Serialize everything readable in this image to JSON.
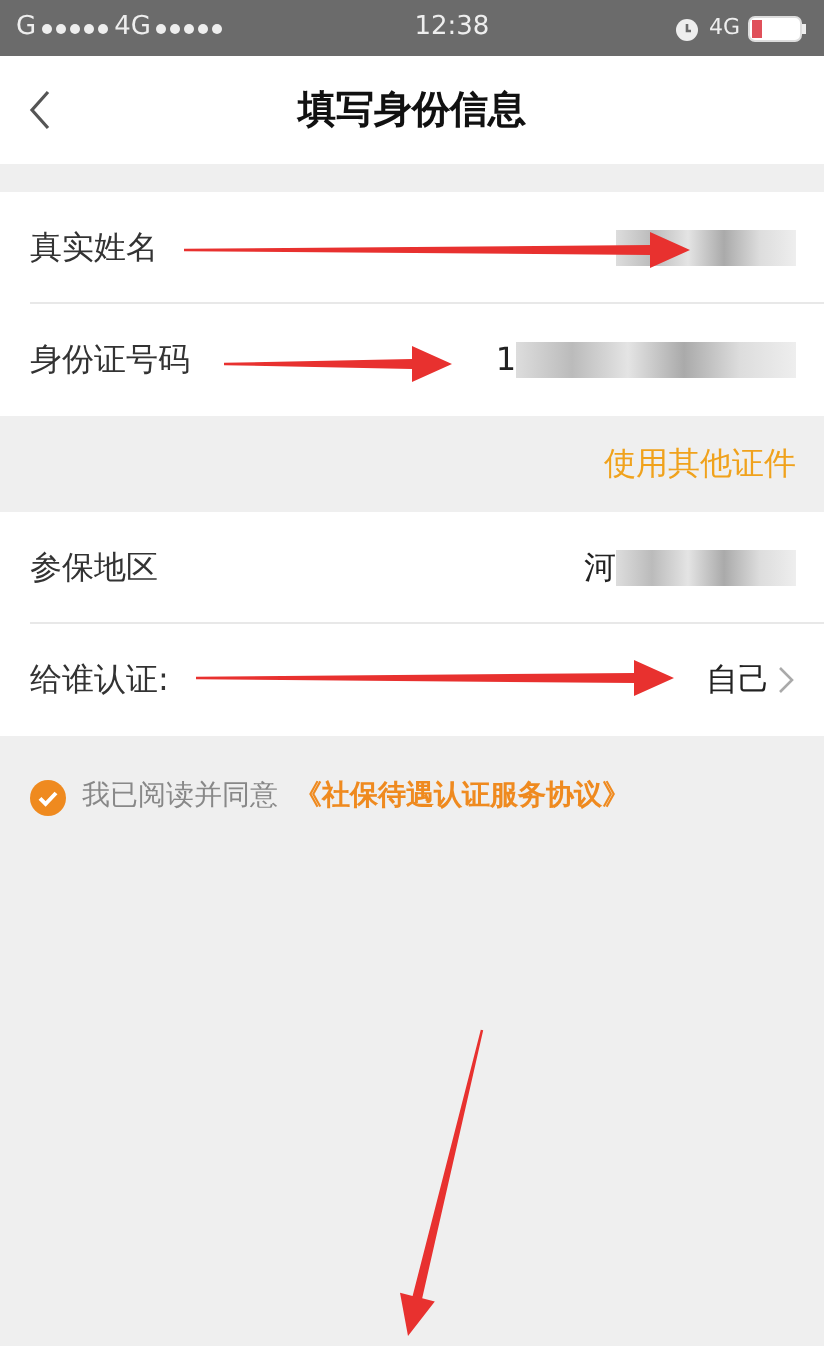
{
  "status_bar": {
    "carrier": "G",
    "network_left": "4G",
    "time": "12:38",
    "network_right": "4G"
  },
  "header": {
    "back": true,
    "title": "填写身份信息"
  },
  "identity_fields": [
    {
      "label": "真实姓名",
      "blurred": true
    },
    {
      "label": "身份证号码",
      "value": "1",
      "blurred": true
    }
  ],
  "other_document_link": "使用其他证件",
  "auth_fields": [
    {
      "label": "参保地区",
      "value": "河",
      "blurred": true,
      "chevron": false
    },
    {
      "label": "给谁认证:",
      "value": "自己",
      "blurred": false,
      "chevron": true
    }
  ],
  "agreement": {
    "checked": true,
    "text": "我已阅读并同意",
    "link": "《社保待遇认证服务协议》"
  },
  "annotations": [
    {
      "kind": "arrow"
    },
    {
      "kind": "arrow"
    },
    {
      "kind": "arrow"
    },
    {
      "kind": "arrow"
    }
  ]
}
